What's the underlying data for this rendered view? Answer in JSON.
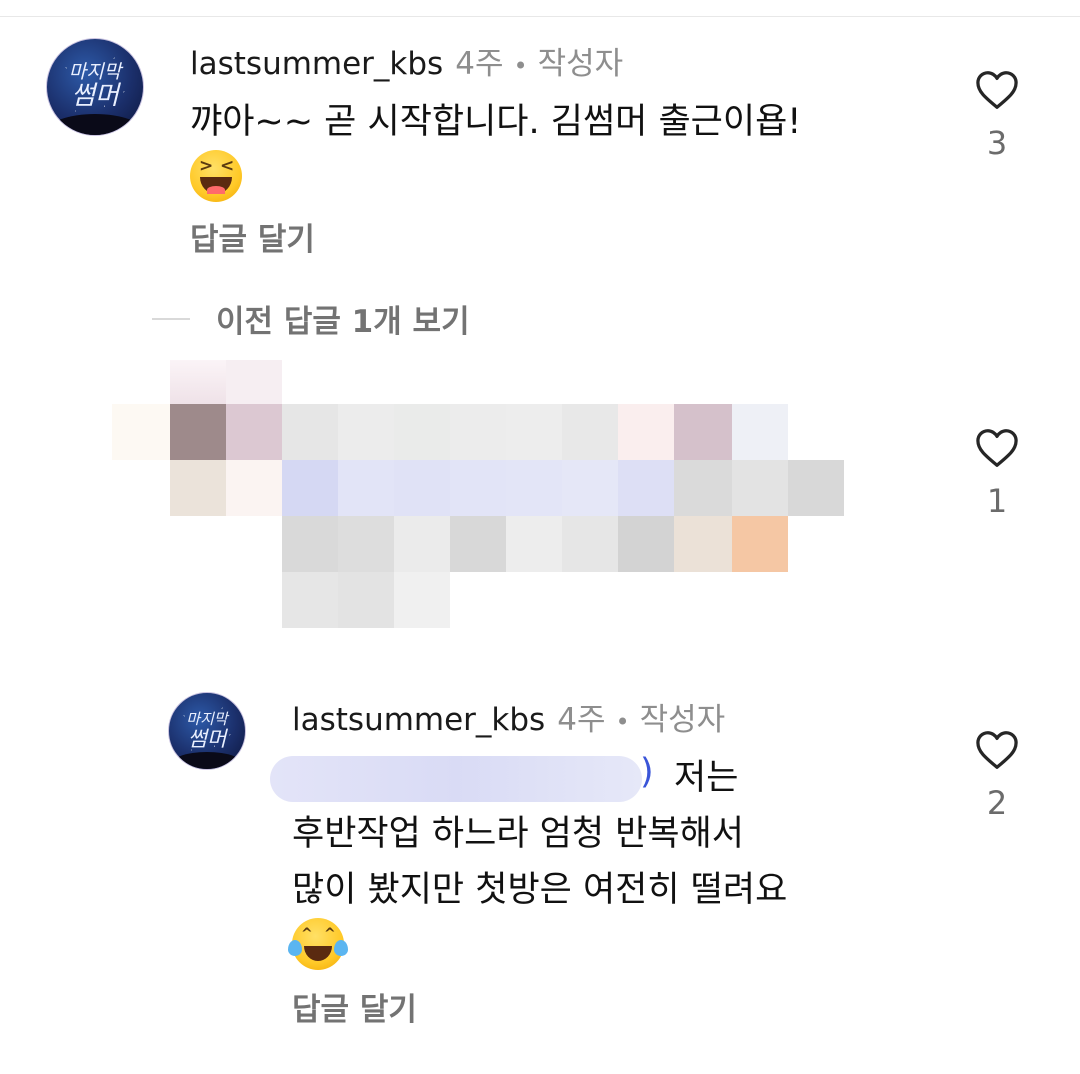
{
  "comments": [
    {
      "username": "lastsummer_kbs",
      "time": "4주",
      "author_badge": "작성자",
      "text": "꺄아~~ 곧 시작합니다. 김썸머 출근이욥!",
      "emoji": "squinting-laughing-emoji",
      "reply_label": "답글 달기",
      "likes": "3",
      "avatar_text": [
        "마지막",
        "썸머"
      ]
    },
    {
      "username": "lastsummer_kbs",
      "time": "4주",
      "author_badge": "작성자",
      "text_lines": [
        "저는",
        "후반작업 하느라 엄청 반복해서",
        "많이 봤지만 첫방은 여전히 떨려요"
      ],
      "emoji": "tears-of-joy-emoji",
      "reply_label": "답글 달기",
      "likes": "2",
      "avatar_text": [
        "마지막",
        "썸머"
      ]
    }
  ],
  "view_previous_replies": "이전 답글 1개 보기",
  "hidden_comment_likes": "1",
  "mention_close_paren": ")",
  "meta_separator": "•",
  "colors": {
    "secondary_text": "#8e8e8e",
    "reply_link": "#737373",
    "mention": "#3a55d8",
    "heart_outline": "#262626"
  }
}
